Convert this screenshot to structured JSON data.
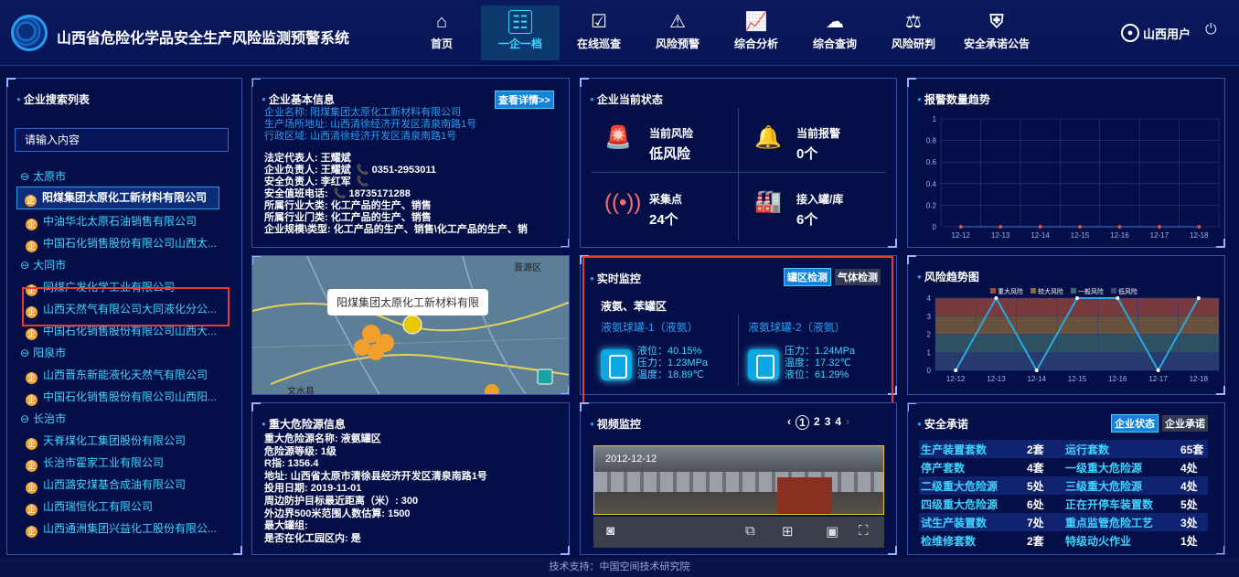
{
  "header": {
    "title": "山西省危险化学品安全生产风险监测预警系统",
    "user": "山西用户",
    "nav": [
      "首页",
      "一企一档",
      "在线巡查",
      "风险预警",
      "综合分析",
      "综合查询",
      "风险研判",
      "安全承诺公告"
    ]
  },
  "left": {
    "title": "企业搜索列表",
    "search_placeholder": "请输入内容",
    "cities": [
      "太原市",
      "大同市",
      "阳泉市",
      "长治市"
    ],
    "companies": [
      "阳煤集团太原化工新材料有限公司",
      "中油华北太原石油销售有限公司",
      "中国石化销售股份有限公司山西太...",
      "同煤广发化学工业有限公司",
      "山西天然气有限公司大同液化分公...",
      "中国石化销售股份有限公司山西大...",
      "山西晋东新能液化天然气有限公司",
      "中国石化销售股份有限公司山西阳...",
      "天脊煤化工集团股份有限公司",
      "长治市霍家工业有限公司",
      "山西潞安煤基合成油有限公司",
      "山西瑞恒化工有限公司",
      "山西通洲集团兴益化工股份有限公..."
    ]
  },
  "basic": {
    "title": "企业基本信息",
    "detail_btn": "查看详情>>",
    "l1": "企业名称: 阳煤集团太原化工新材料有限公司",
    "l2": "生产场所地址: 山西清徐经济开发区清泉南路1号",
    "l3": "行政区域: 山西清徐经济开发区清泉南路1号",
    "w1": "法定代表人: 王耀斌",
    "w2": "企业负责人: 王耀斌",
    "w2p": "📞 0351-2953011",
    "w3": "安全负责人: 李红军",
    "w3p": "📞",
    "w4": "安全值班电话:",
    "w4p": "📞 18735171288",
    "w5": "所属行业大类: 化工产品的生产、销售",
    "w6": "所属行业门类: 化工产品的生产、销售",
    "w7": "企业规模\\类型: 化工产品的生产、销售\\化工产品的生产、销"
  },
  "map": {
    "popup": "阳煤集团太原化工新材料有限",
    "label1": "文水县",
    "label2": "晋源区"
  },
  "hazard": {
    "title": "重大危险源信息",
    "lines": [
      "重大危险源名称: 液氨罐区",
      "危险源等级: 1级",
      "R指: 1356.4",
      "地址: 山西省太原市清徐县经济开发区清泉南路1号",
      "投用日期: 2019-11-01",
      "周边防护目标最近距离（米）: 300",
      "外边界500米范围人数估算: 1500",
      "最大罐组:",
      "是否在化工园区内: 是"
    ]
  },
  "status": {
    "title": "企业当前状态",
    "items": [
      {
        "k": "当前风险",
        "v": "低风险"
      },
      {
        "k": "当前报警",
        "v": "0个"
      },
      {
        "k": "采集点",
        "v": "24个"
      },
      {
        "k": "接入罐/库",
        "v": "6个"
      }
    ]
  },
  "monitor": {
    "title": "实时监控",
    "tab1": "罐区检测",
    "tab2": "气体检测",
    "area": "液氨、苯罐区",
    "t1": {
      "name": "液氨球罐-1（液氨）",
      "a": "液位：40.15%",
      "b": "压力：1.23MPa",
      "c": "温度：18.89℃"
    },
    "t2": {
      "name": "液氨球罐-2（液氨）",
      "a": "压力：1.24MPa",
      "b": "温度：17.32℃",
      "c": "液位：61.29%"
    }
  },
  "video": {
    "title": "视频监控",
    "pages": [
      "1",
      "2",
      "3",
      "4"
    ],
    "osd": "2012-12-12"
  },
  "alarm": {
    "title": "报警数量趋势"
  },
  "risk": {
    "title": "风险趋势图",
    "legend": [
      "重大风险",
      "较大风险",
      "一般风险",
      "低风险"
    ]
  },
  "chart_data": [
    {
      "type": "line",
      "title": "报警数量趋势",
      "x": [
        "12-12",
        "12-13",
        "12-14",
        "12-15",
        "12-16",
        "12-17",
        "12-18"
      ],
      "series": [
        {
          "values": [
            0,
            0,
            0,
            0,
            0,
            0,
            0
          ]
        }
      ],
      "ylim": [
        0,
        1
      ],
      "yticks": [
        "0",
        "0.2",
        "0.4",
        "0.6",
        "0.8",
        "1"
      ]
    },
    {
      "type": "line",
      "title": "风险趋势图",
      "x": [
        "12-12",
        "12-13",
        "12-14",
        "12-15",
        "12-16",
        "12-17",
        "12-18"
      ],
      "series": [
        {
          "values": [
            0,
            4,
            0,
            4,
            4,
            0,
            4
          ]
        }
      ],
      "ylim": [
        0,
        4
      ],
      "yticks": [
        "0",
        "1",
        "2",
        "3",
        "4"
      ],
      "legend": [
        "重大风险",
        "较大风险",
        "一般风险",
        "低风险"
      ],
      "colors": [
        "#a04a3a",
        "#8a6a3a",
        "#3a6a6a",
        "#34497a"
      ]
    }
  ],
  "safety": {
    "title": "安全承诺",
    "tab1": "企业状态",
    "tab2": "企业承诺",
    "rows": [
      [
        "生产装置套数",
        "2套",
        "运行套数",
        "65套"
      ],
      [
        "停产套数",
        "4套",
        "一级重大危险源",
        "4处"
      ],
      [
        "二级重大危险源",
        "5处",
        "三级重大危险源",
        "4处"
      ],
      [
        "四级重大危险源",
        "6处",
        "正在开停车装置数",
        "5处"
      ],
      [
        "试生产装置数",
        "7处",
        "重点监管危险工艺",
        "3处"
      ],
      [
        "检维修套数",
        "2套",
        "特级动火作业",
        "1处"
      ]
    ]
  },
  "footer": "技术支持：中国空间技术研究院"
}
